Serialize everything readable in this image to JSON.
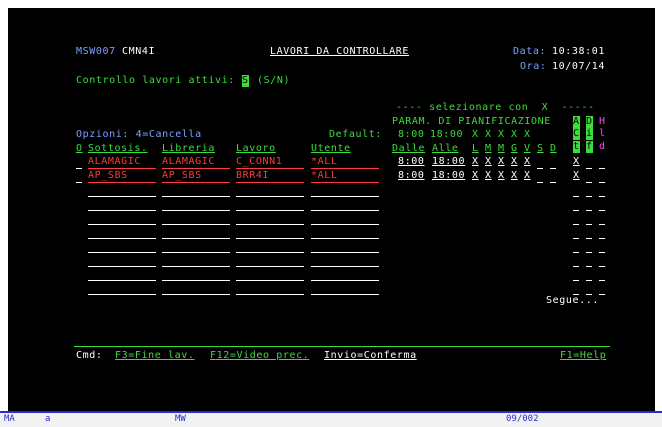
{
  "header": {
    "program": "MSW007",
    "user": "CMN4I",
    "title": "LAVORI DA CONTROLLARE",
    "date_label": "Data:",
    "date_value": "10:38:01",
    "time_label": "Ora:",
    "time_value": "10/07/14"
  },
  "control": {
    "label": "Controllo lavori attivi:",
    "value": "S",
    "hint": "(S/N)"
  },
  "selection_hint": "---- selezionare con  X  -----",
  "param_title": "PARAM. DI PIANIFICAZIONE",
  "options_label": "Opzioni: 4=Cancella",
  "defaults": {
    "label": "Default:",
    "from": "8:00",
    "to": "18:00",
    "days": [
      "X",
      "X",
      "X",
      "X",
      "X"
    ]
  },
  "vertical_headers": {
    "col1": [
      "A",
      "C",
      "t"
    ],
    "col2": [
      "D",
      "i",
      "f"
    ],
    "col3": [
      "H",
      "l",
      "d"
    ]
  },
  "columns": {
    "opt": "O",
    "subsystem": "Sottosis.",
    "library": "Libreria",
    "job": "Lavoro",
    "user": "Utente",
    "from": "Dalle",
    "to": "Alle",
    "days": [
      "L",
      "M",
      "M",
      "G",
      "V",
      "S",
      "D"
    ]
  },
  "rows": [
    {
      "subsystem": "ALAMAGIC",
      "library": "ALAMAGIC",
      "job": "C_CONN1",
      "user": "*ALL",
      "from": "8:00",
      "to": "18:00",
      "days": [
        "X",
        "X",
        "X",
        "X",
        "X"
      ],
      "act": "X"
    },
    {
      "subsystem": "AP_SBS",
      "library": "AP_SBS",
      "job": "BRR4I",
      "user": "*ALL",
      "from": "8:00",
      "to": "18:00",
      "days": [
        "X",
        "X",
        "X",
        "X",
        "X"
      ],
      "act": "X"
    }
  ],
  "more": "Segue...",
  "command": {
    "label": "Cmd:",
    "f3": "F3=Fine lav.",
    "f12": "F12=Video prec.",
    "enter": "Invio=Conferma",
    "f1": "F1=Help"
  },
  "status_bar": {
    "mode": "MA",
    "session": "a",
    "indicator": "MW",
    "position": "09/002"
  },
  "colors": {
    "background": "#000000",
    "field": "#ffffff",
    "label": "#7aa0ff",
    "prompt": "#3ddc3d",
    "data": "#ff3b3b",
    "accent": "#ff44ff"
  }
}
